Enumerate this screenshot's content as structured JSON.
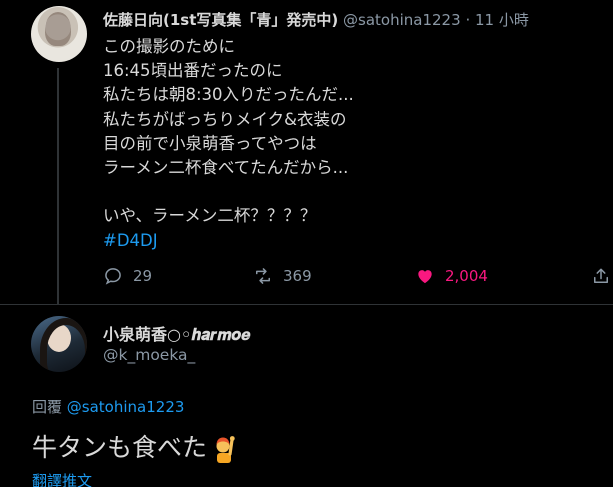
{
  "original_tweet": {
    "display_name": "佐藤日向(1st写真集「青」発売中)",
    "handle": "@satohina1223",
    "separator": "·",
    "time": "11 小時",
    "lines": [
      "この撮影のために",
      "16:45頃出番だったのに",
      "私たちは朝8:30入りだったんだ...",
      "私たちがばっちりメイク&衣装の",
      "目の前で小泉萌香ってやつは",
      "ラーメン二杯食べてたんだから...",
      "",
      "いや、ラーメン二杯？？？？"
    ],
    "hashtag": "#D4DJ",
    "actions": {
      "reply_count": "29",
      "retweet_count": "369",
      "like_count": "2,004"
    }
  },
  "reply": {
    "display_name": "小泉萌香○◦𝒉𝒂𝒓𝒎𝒐𝒆",
    "handle": "@k_moeka_",
    "reply_label": "回覆",
    "reply_mention": "@satohina1223",
    "text": "牛タンも食べた",
    "emoji": "person-raising-hand-emoji",
    "translate_label": "翻譯推文"
  },
  "colors": {
    "background": "#000000",
    "text": "#d9d9d9",
    "secondary": "#8b98a5",
    "link": "#1d9bf0",
    "like": "#f91880"
  }
}
